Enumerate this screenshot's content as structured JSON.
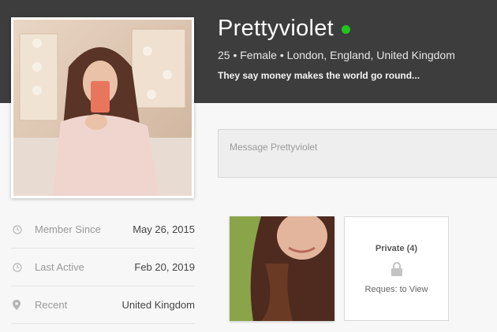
{
  "profile": {
    "username": "Prettyviolet",
    "status_color": "#22c41f",
    "meta": "25 • Female • London, England, United Kingdom",
    "tagline": "They say money makes the world go round..."
  },
  "message": {
    "placeholder": "Message Prettyviolet"
  },
  "info": [
    {
      "icon": "clock-icon",
      "label": "Member Since",
      "value": "May 26, 2015"
    },
    {
      "icon": "clock-icon",
      "label": "Last Active",
      "value": "Feb 20, 2019"
    },
    {
      "icon": "map-pin-icon",
      "label": "Recent",
      "value": "United Kingdom"
    }
  ],
  "gallery": {
    "private_title": "Private (4)",
    "private_action": "Reques: to View"
  },
  "colors": {
    "header": "#3d3d3d",
    "background": "#f7f7f7"
  }
}
